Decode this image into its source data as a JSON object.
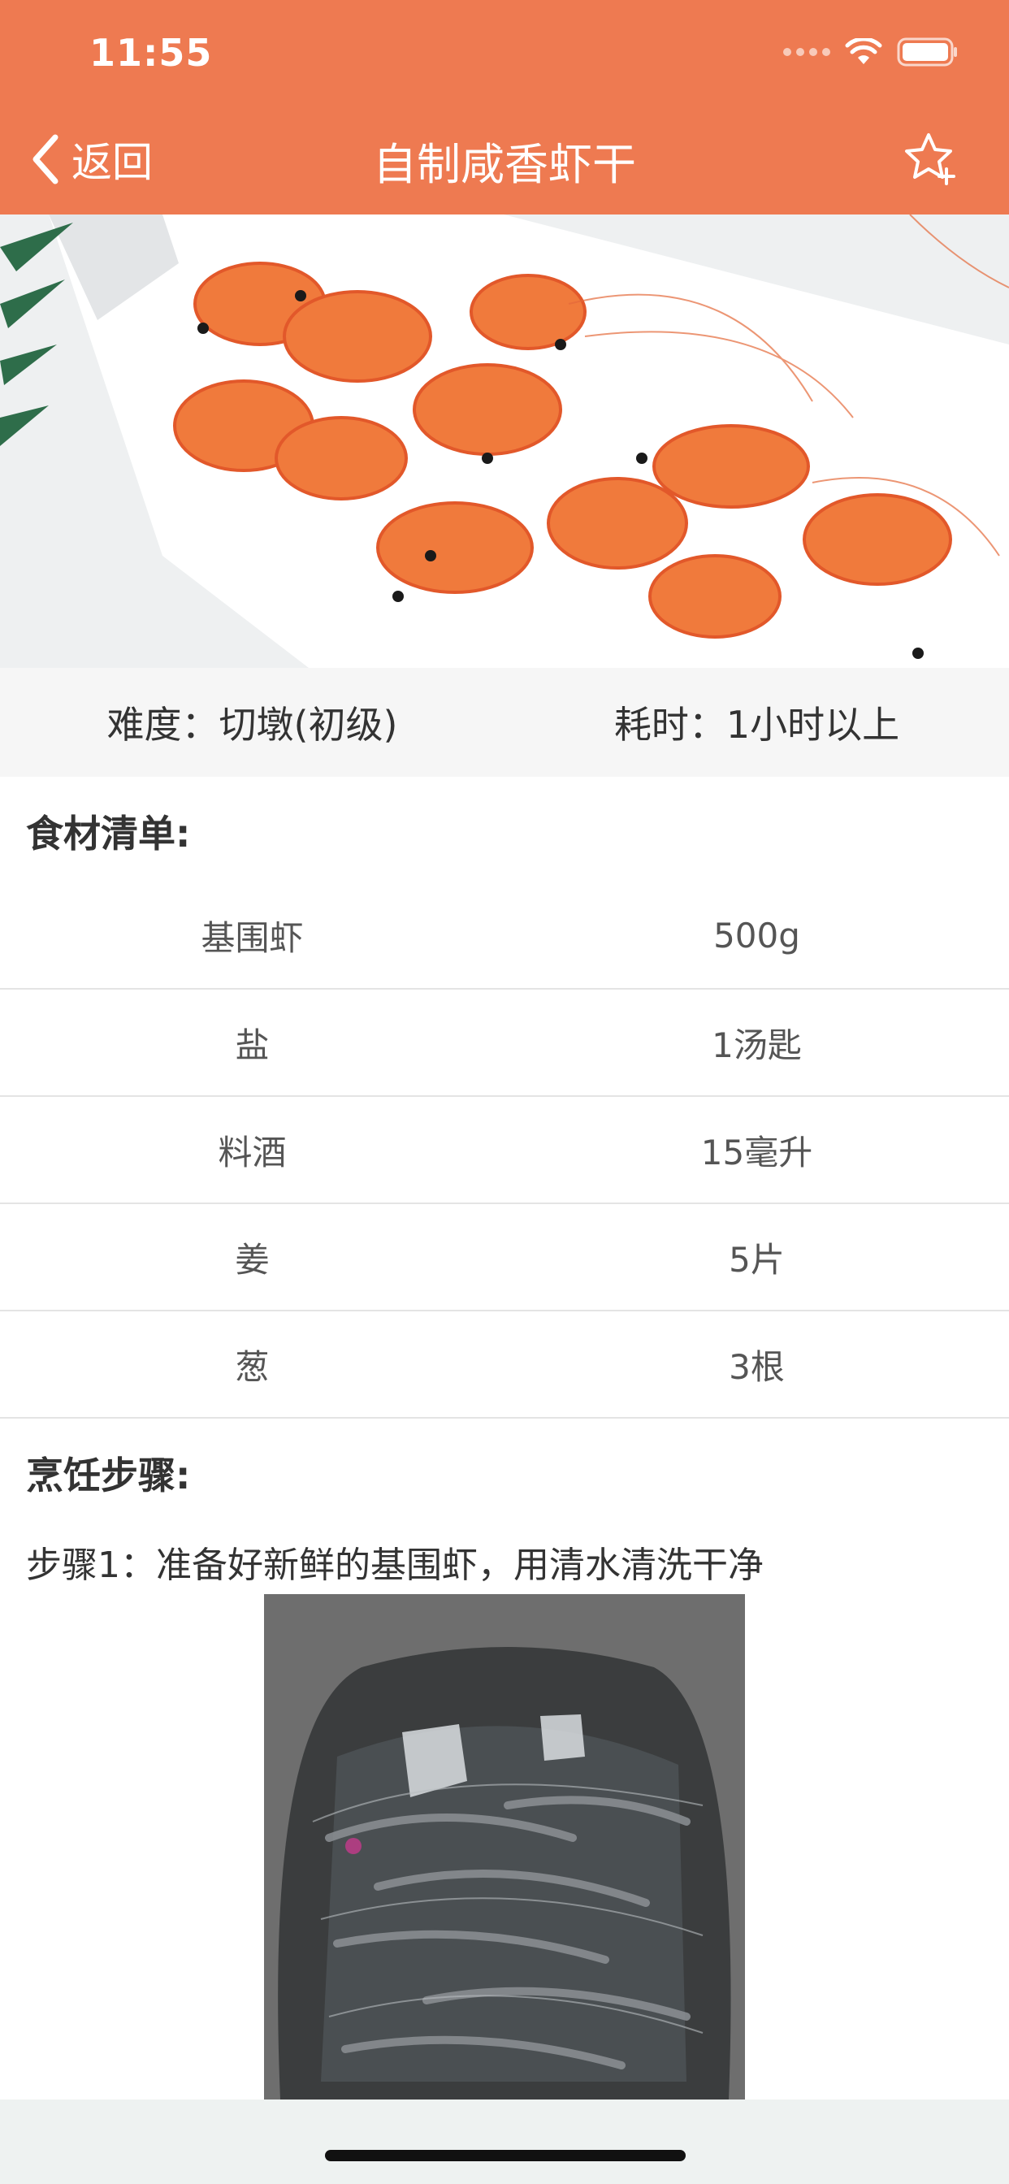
{
  "status_bar": {
    "time": "11:55"
  },
  "nav": {
    "back_label": "返回",
    "title": "自制咸香虾干",
    "header_color": "#EE7A51"
  },
  "meta": {
    "difficulty": "难度：切墩(初级)",
    "duration": "耗时：1小时以上"
  },
  "ingredients": {
    "title": "食材清单:",
    "items": [
      {
        "name": "基围虾",
        "amount": "500g"
      },
      {
        "name": "盐",
        "amount": "1汤匙"
      },
      {
        "name": "料酒",
        "amount": "15毫升"
      },
      {
        "name": "姜",
        "amount": "5片"
      },
      {
        "name": "葱",
        "amount": "3根"
      }
    ]
  },
  "steps": {
    "title": "烹饪步骤:",
    "items": [
      {
        "text": "步骤1：准备好新鲜的基围虾，用清水清洗干净"
      }
    ]
  },
  "icons": {
    "back": "chevron-left-icon",
    "favorite": "star-plus-icon",
    "wifi": "wifi-icon",
    "battery": "battery-icon"
  }
}
